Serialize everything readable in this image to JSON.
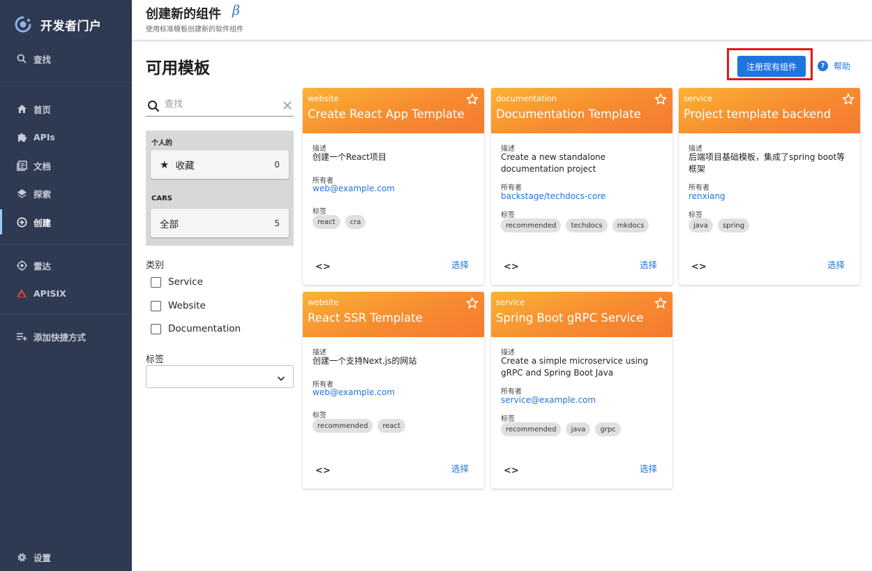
{
  "sidebar": {
    "brand": "开发者门户",
    "search": "查找",
    "items": [
      {
        "label": "首页",
        "icon": "home-icon"
      },
      {
        "label": "APIs",
        "icon": "puzzle-icon"
      },
      {
        "label": "文档",
        "icon": "docs-icon"
      },
      {
        "label": "探索",
        "icon": "layers-icon"
      },
      {
        "label": "创建",
        "icon": "add-circle-icon"
      },
      {
        "label": "雷达",
        "icon": "radar-icon"
      },
      {
        "label": "APISIX",
        "icon": "apisix-icon"
      },
      {
        "label": "添加快捷方式",
        "icon": "playlist-add-icon"
      }
    ],
    "settings": "设置",
    "active_index": 4
  },
  "header": {
    "title": "创建新的组件",
    "beta": "β",
    "subtitle": "使用标准模板创建新的软件组件"
  },
  "main": {
    "page_title": "可用模板",
    "register_button": "注册现有组件",
    "help": "帮助"
  },
  "filters": {
    "search_placeholder": "查找",
    "personal_group": "个人的",
    "favorites": {
      "label": "收藏",
      "count": "0"
    },
    "org_group": "CARS",
    "all": {
      "label": "全部",
      "count": "5"
    },
    "categories_label": "类别",
    "categories": [
      "Service",
      "Website",
      "Documentation"
    ],
    "tags_label": "标签"
  },
  "card_labels": {
    "description": "描述",
    "owner": "所有者",
    "tags": "标签",
    "choose": "选择",
    "code_icon": "<>"
  },
  "cards": [
    {
      "type": "website",
      "title": "Create React App Template",
      "description": "创建一个React项目",
      "owner": "web@example.com",
      "tags": [
        "react",
        "cra"
      ]
    },
    {
      "type": "documentation",
      "title": "Documentation Template",
      "description": "Create a new standalone documentation project",
      "owner": "backstage/techdocs-core",
      "tags": [
        "recommended",
        "techdocs",
        "mkdocs"
      ]
    },
    {
      "type": "service",
      "title": "Project template backend",
      "description": "后端项目基础模板，集成了spring boot等框架",
      "owner": "renxiang",
      "tags": [
        "java",
        "spring"
      ]
    },
    {
      "type": "website",
      "title": "React SSR Template",
      "description": "创建一个支持Next.js的网站",
      "owner": "web@example.com",
      "tags": [
        "recommended",
        "react"
      ]
    },
    {
      "type": "service",
      "title": "Spring Boot gRPC Service",
      "description": "Create a simple microservice using gRPC and Spring Boot Java",
      "owner": "service@example.com",
      "tags": [
        "recommended",
        "java",
        "grpc"
      ]
    }
  ],
  "colors": {
    "sidebar_bg": "#2e3a52",
    "accent": "#1f75e0",
    "card_header_orange": "#f68b30",
    "highlight_red": "#e11717"
  }
}
